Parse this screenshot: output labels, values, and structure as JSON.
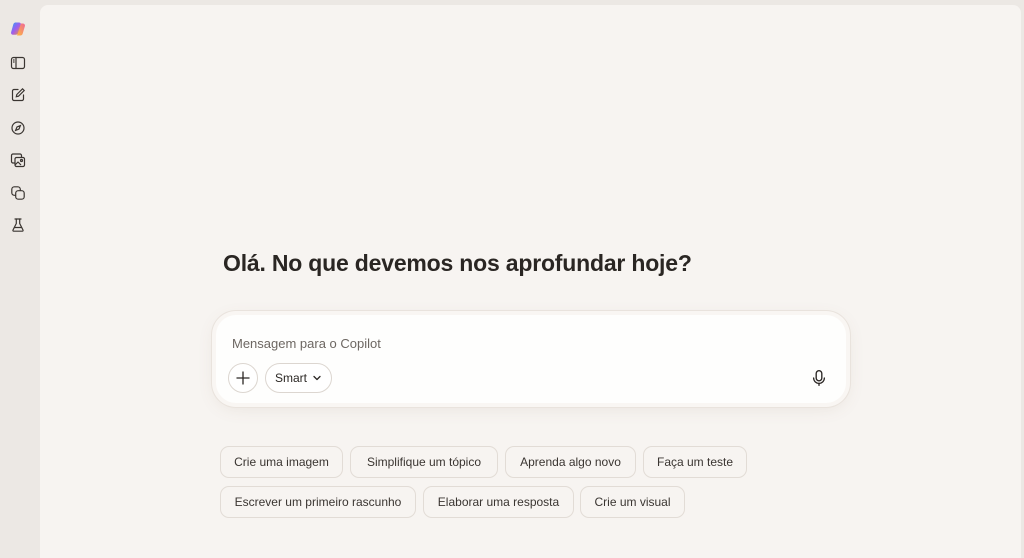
{
  "sidebar": {
    "items": [
      {
        "icon": "copilot-logo-icon"
      },
      {
        "icon": "sidebar-toggle-icon"
      },
      {
        "icon": "new-chat-icon"
      },
      {
        "icon": "discover-compass-icon"
      },
      {
        "icon": "image-gallery-icon"
      },
      {
        "icon": "pages-copy-icon"
      },
      {
        "icon": "labs-flask-icon"
      }
    ]
  },
  "main": {
    "greeting": "Olá. No que devemos nos aprofundar hoje?",
    "composer": {
      "placeholder": "Mensagem para o Copilot",
      "value": "",
      "mode_label": "Smart"
    },
    "suggestions": [
      "Crie uma imagem",
      "Simplifique um tópico",
      "Aprenda algo novo",
      "Faça um teste",
      "Escrever um primeiro rascunho",
      "Elaborar uma resposta",
      "Crie um visual"
    ]
  },
  "colors": {
    "page_background": "#f7f4f1",
    "sidebar_background": "#ece8e4",
    "text": "#2a2623"
  }
}
